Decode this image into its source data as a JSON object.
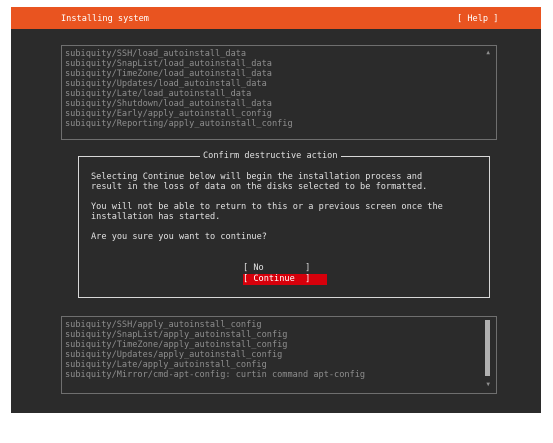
{
  "header": {
    "title": "Installing system",
    "help_label": "[ Help ]"
  },
  "log_top": {
    "lines": [
      "subiquity/SSH/load_autoinstall_data",
      "subiquity/SnapList/load_autoinstall_data",
      "subiquity/TimeZone/load_autoinstall_data",
      "subiquity/Updates/load_autoinstall_data",
      "subiquity/Late/load_autoinstall_data",
      "subiquity/Shutdown/load_autoinstall_data",
      "subiquity/Early/apply_autoinstall_config",
      "subiquity/Reporting/apply_autoinstall_config"
    ],
    "scroll_up_glyph": "▲"
  },
  "dialog": {
    "title": "Confirm destructive action",
    "lines": [
      "Selecting Continue below will begin the installation process and",
      "result in the loss of data on the disks selected to be formatted.",
      "",
      "You will not be able to return to this or a previous screen once the",
      "installation has started.",
      "",
      "Are you sure you want to continue?"
    ],
    "no_label": "[ No        ]",
    "continue_label": "[ Continue  ]"
  },
  "log_bottom": {
    "lines": [
      "subiquity/SSH/apply_autoinstall_config",
      "subiquity/SnapList/apply_autoinstall_config",
      "subiquity/TimeZone/apply_autoinstall_config",
      "subiquity/Updates/apply_autoinstall_config",
      "subiquity/Late/apply_autoinstall_config",
      "subiquity/Mirror/cmd-apt-config: curtin command apt-config"
    ],
    "scroll_down_glyph": "▼"
  },
  "colors": {
    "header_bg": "#e95420",
    "screen_bg": "#2b2b2b",
    "button_selected_bg": "#d6000b",
    "log_text": "#8e8e8e"
  }
}
